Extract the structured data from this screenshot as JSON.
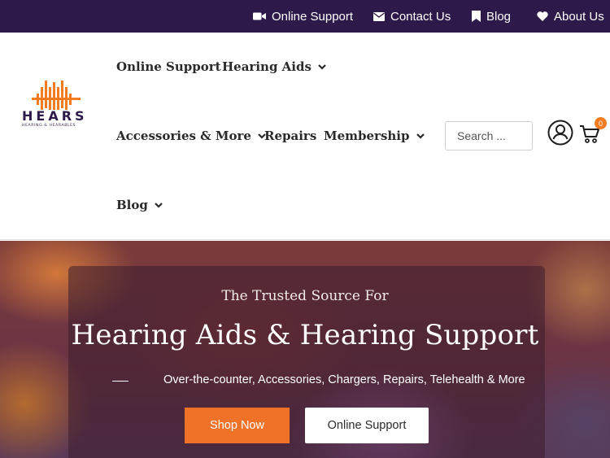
{
  "topbar": {
    "links": [
      {
        "label": "Online Support",
        "icon": "video-camera-icon"
      },
      {
        "label": "Contact Us",
        "icon": "envelope-icon"
      },
      {
        "label": "Blog",
        "icon": "bookmark-icon"
      },
      {
        "label": "About Us",
        "icon": "heart-icon"
      }
    ]
  },
  "logo": {
    "wordmark": "HEARS",
    "tagline": "HEARING & HEARABLES"
  },
  "nav": {
    "items": [
      {
        "label": "Online Support"
      },
      {
        "label": "Hearing Aids"
      },
      {
        "label": "Accessories & More"
      },
      {
        "label": "Repairs"
      },
      {
        "label": "Membership"
      },
      {
        "label": "Blog"
      }
    ]
  },
  "search": {
    "placeholder": "Search ..."
  },
  "cart": {
    "count": "0"
  },
  "hero": {
    "kicker": "The Trusted Source For",
    "title": "Hearing Aids & Hearing Support",
    "subtitle": "Over-the-counter, Accessories, Chargers, Repairs, Telehealth & More",
    "primary_button": "Shop Now",
    "secondary_button": "Online Support"
  },
  "colors": {
    "topbar": "#2e1a4a",
    "brand_orange": "#f47b20",
    "brand_purple": "#2e1a4a"
  }
}
